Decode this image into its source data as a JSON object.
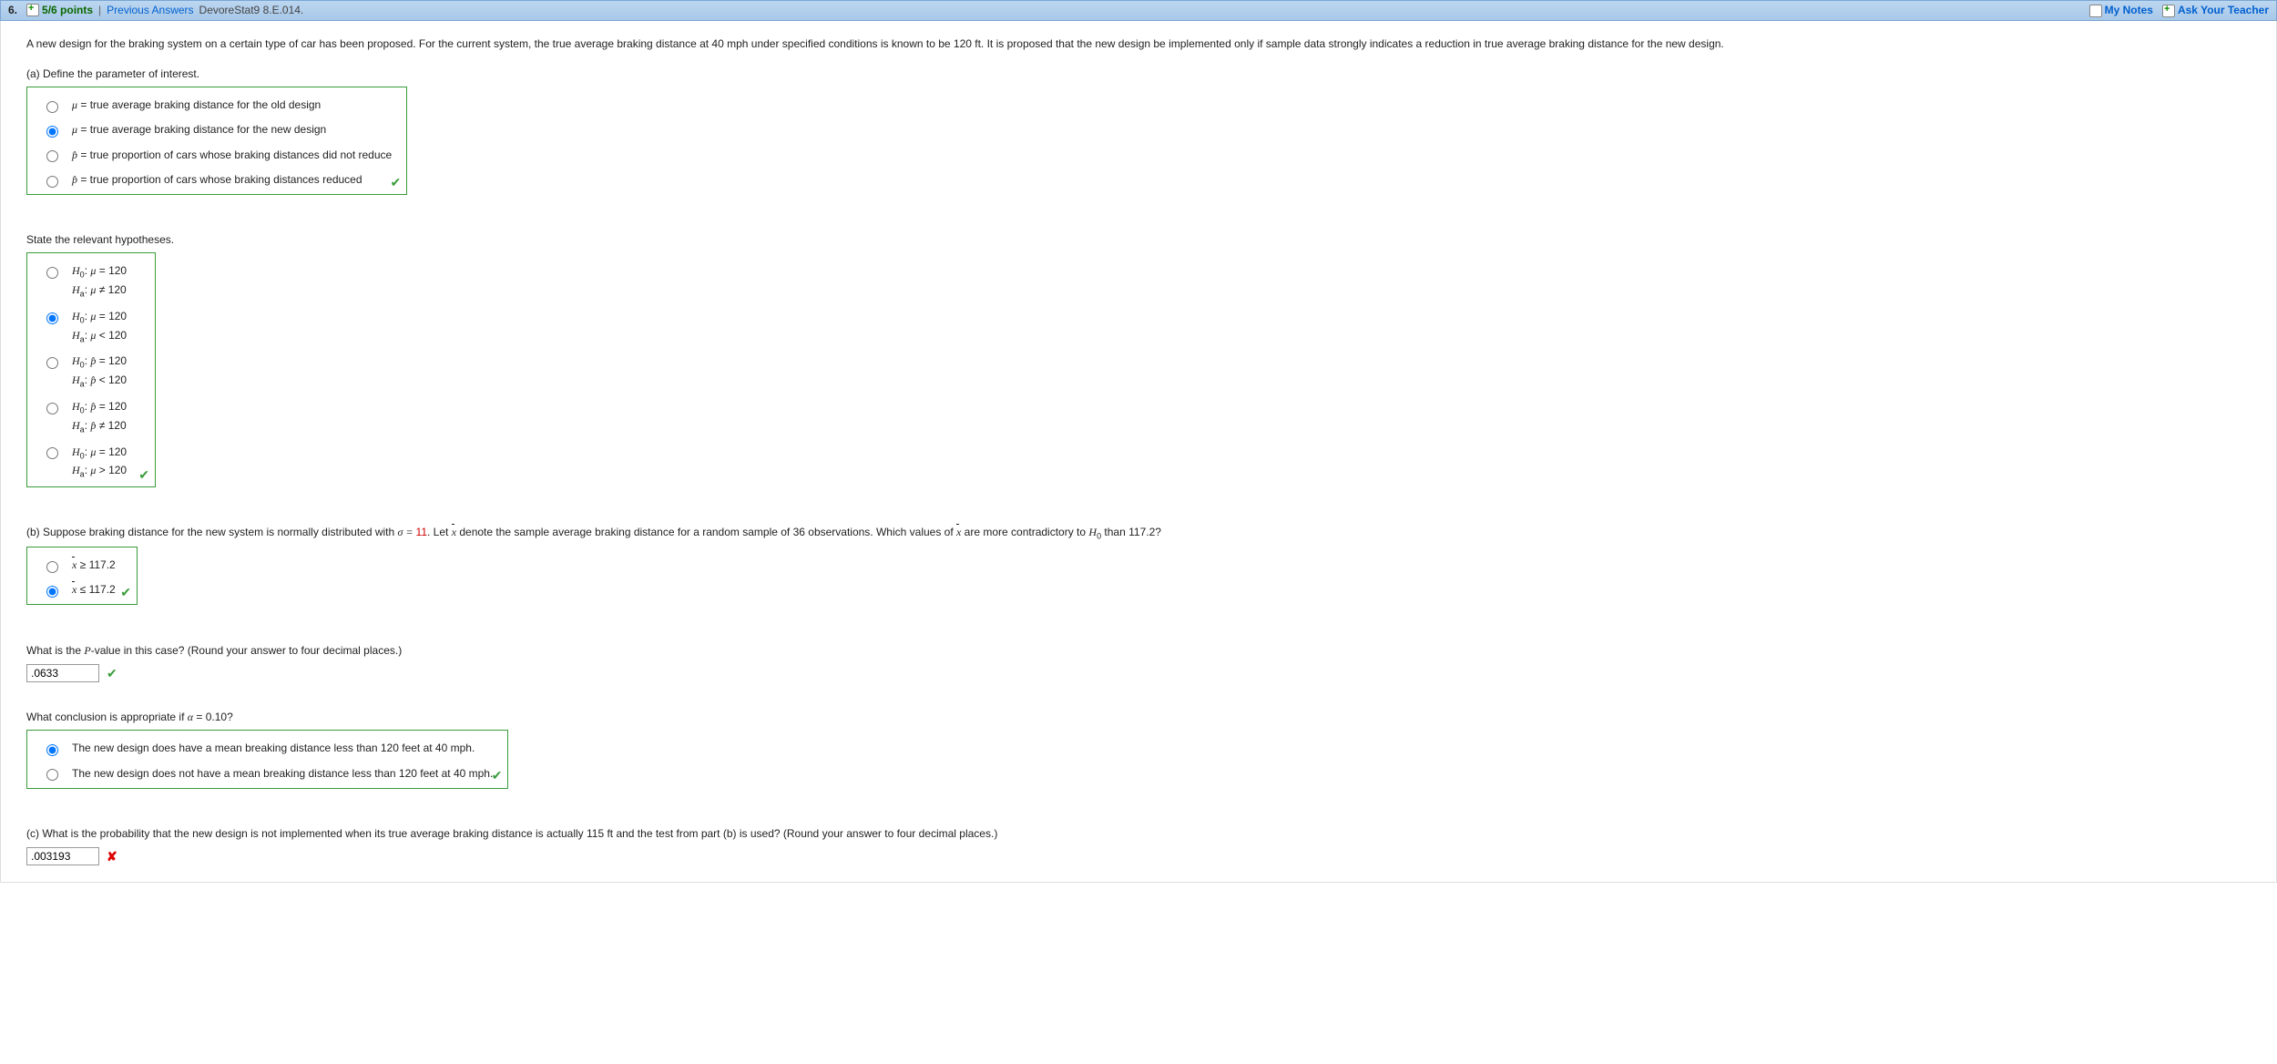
{
  "header": {
    "qnum": "6.",
    "points": "5/6 points",
    "sep": "|",
    "prev": "Previous Answers",
    "ref": "DevoreStat9 8.E.014.",
    "mynotes": "My Notes",
    "ask": "Ask Your Teacher"
  },
  "prompt": "A new design for the braking system on a certain type of car has been proposed. For the current system, the true average braking distance at 40 mph under specified conditions is known to be 120 ft. It is proposed that the new design be implemented only if sample data strongly indicates a reduction in true average braking distance for the new design.",
  "a": {
    "label": "(a) Define the parameter of interest.",
    "opts": [
      "μ = true average braking distance for the old design",
      "μ = true average braking distance for the new design",
      "p̂ = true proportion of cars whose braking distances did not reduce",
      "p̂ = true proportion of cars whose braking distances reduced"
    ]
  },
  "hyp": {
    "label": "State the relevant hypotheses.",
    "h0": "H",
    "sub0": "0",
    "ha": "H",
    "suba": "a",
    "mu": "μ",
    "phat": "p̂",
    "v": "120",
    "ops": {
      "eq": " = ",
      "ne": " ≠ ",
      "lt": " < ",
      "gt": " > "
    }
  },
  "b": {
    "pre": "(b) Suppose braking distance for the new system is normally distributed with ",
    "sigma": "σ = ",
    "sval": "11",
    "mid": ". Let ",
    "post": " denote the sample average braking distance for a random sample of 36 observations. Which values of ",
    "tail1": " are more contradictory to ",
    "tail2": " than 117.2?",
    "o1a": "x",
    "o1b": " ≥ 117.2",
    "o2a": "x",
    "o2b": " ≤ 117.2"
  },
  "pval": {
    "q": "What is the P-value in this case? (Round your answer to four decimal places.)",
    "ans": ".0633"
  },
  "concl": {
    "q": "What conclusion is appropriate if α = 0.10?",
    "o1": "The new design does have a mean breaking distance less than 120 feet at 40 mph.",
    "o2": "The new design does not have a mean breaking distance less than 120 feet at 40 mph."
  },
  "c": {
    "q": "(c) What is the probability that the new design is not implemented when its true average braking distance is actually 115 ft and the test from part (b) is used? (Round your answer to four decimal places.)",
    "ans": ".003193"
  }
}
